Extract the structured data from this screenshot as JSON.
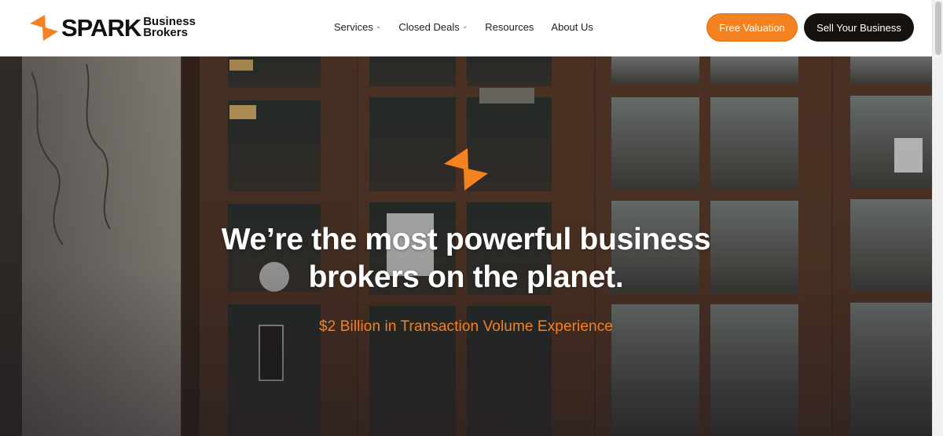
{
  "brand": {
    "name": "SPARK",
    "sub_line1": "Business",
    "sub_line2": "Brokers",
    "accent_color": "#f58220",
    "icon": "spark-bolt-icon"
  },
  "nav": {
    "items": [
      {
        "label": "Services",
        "has_dropdown": true
      },
      {
        "label": "Closed Deals",
        "has_dropdown": true
      },
      {
        "label": "Resources",
        "has_dropdown": false
      },
      {
        "label": "About Us",
        "has_dropdown": false
      }
    ],
    "dropdown_icon": "chevron-down-icon"
  },
  "cta": {
    "valuation_label": "Free Valuation",
    "sell_label": "Sell Your Business",
    "valuation_color": "#f58220",
    "sell_color": "#17120e"
  },
  "hero": {
    "icon": "spark-bolt-icon",
    "title_line1": "We’re the most powerful business",
    "title_line2": "brokers on the planet.",
    "subtitle": "$2 Billion in Transaction Volume Experience",
    "background": "storefront-photo"
  }
}
